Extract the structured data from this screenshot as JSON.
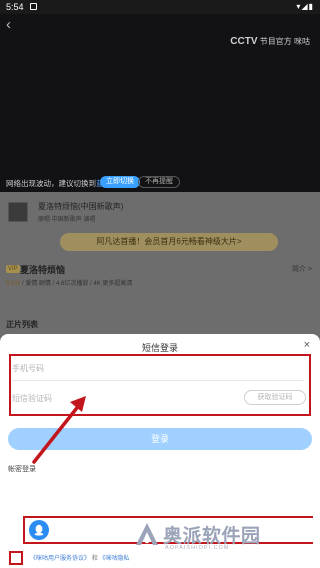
{
  "status_bar": {
    "time": "5:54",
    "right_icons": "▾◢▮"
  },
  "video": {
    "back_glyph": "‹",
    "channel_logo": {
      "brand": "CCTV",
      "app": "节目官方",
      "partner": "咪咕"
    },
    "network_tip": {
      "prefix": "网络出现波动，建议切换到",
      "highlight": "蓝光"
    },
    "switch_button": "立即切换",
    "no_prompt_button": "不再提醒"
  },
  "background": {
    "song_title": "夏洛特烦恼(中国新歌声)",
    "song_subtitle": "原唱 中国新歌声 演唱",
    "promo_banner": "阿凡达首播！会员首月6元畅看神级大片>",
    "vip_badge": "VIP",
    "show_title": "夏洛特烦恼",
    "intro_link": "简介 >",
    "show_meta": {
      "score": "8.5分",
      "rest": " / 爱情 剧情 / 4.6亿次播放 / 4K 更多超高清"
    },
    "section_title": "正片列表"
  },
  "login_sheet": {
    "title": "短信登录",
    "close_glyph": "×",
    "phone_placeholder": "手机号码",
    "code_placeholder": "短信验证码",
    "get_code_button": "获取验证码",
    "login_button": "登录",
    "password_login": "帐密登录",
    "third_party_icon": "qq-icon",
    "agreement": {
      "link1": "《咪咕用户服务协议》",
      "and": "和",
      "link2": "《咪咕隐私"
    }
  },
  "watermark": {
    "title": "奥派软件园",
    "url": "AOPAISHIOPI.COM"
  },
  "colors": {
    "accent": "#3aa0ff",
    "login_button": "#9fd0ff",
    "annotation": "#c3161c"
  }
}
